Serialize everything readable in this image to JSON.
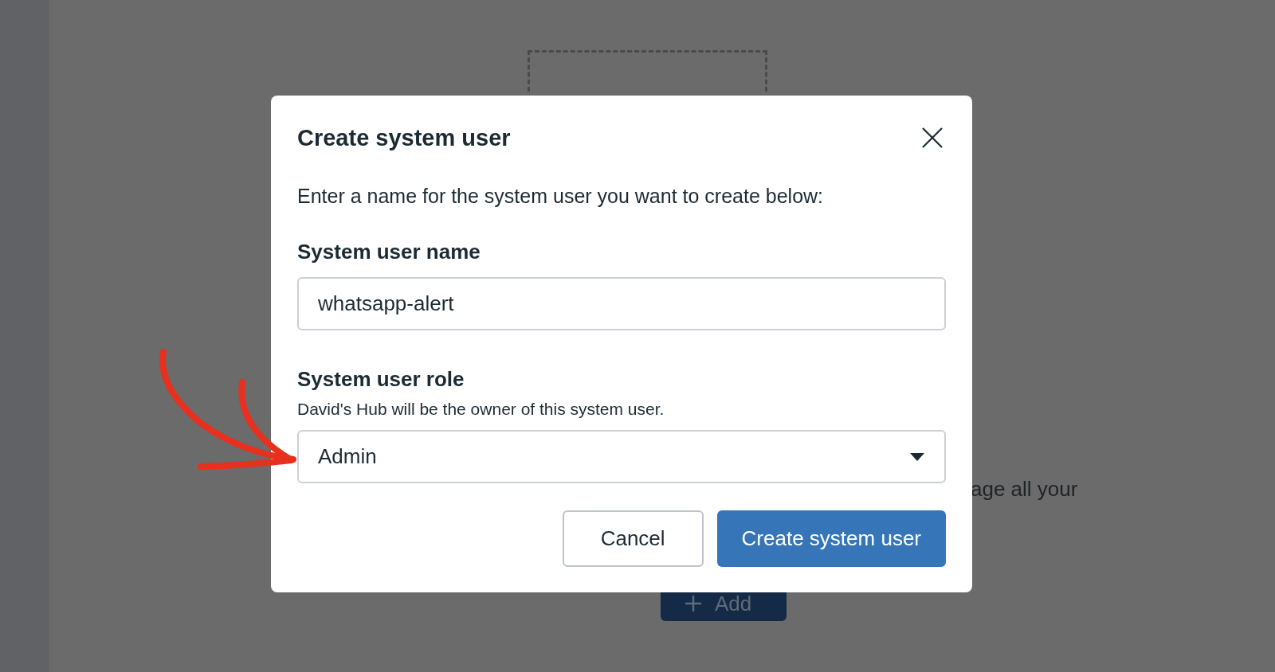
{
  "background": {
    "text": "age all your",
    "add_button": {
      "label": "Add"
    }
  },
  "dialog": {
    "title": "Create system user",
    "description": "Enter a name for the system user you want to create below:",
    "fields": [
      {
        "kind": "text",
        "label": "System user name",
        "value": "whatsapp-alert"
      },
      {
        "kind": "select",
        "label": "System user role",
        "helper": "David's Hub will be the owner of this system user.",
        "value": "Admin"
      }
    ],
    "buttons": [
      {
        "kind": "secondary",
        "label": "Cancel"
      },
      {
        "kind": "primary",
        "label": "Create system user"
      }
    ]
  }
}
